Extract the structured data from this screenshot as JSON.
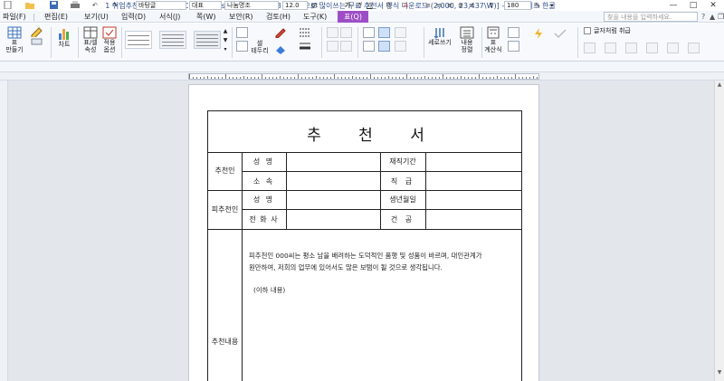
{
  "window": {
    "title": "1 취업추천서 양식.hwp [C:\\Users\\User\\Desktop\\338 일반적으로 많이쓰는 무료 추천서 양식 다운로드 (2,000, 23,437\\W)] - 한컴오피스 한글",
    "minimize": "—",
    "maximize": "□",
    "close": "✕"
  },
  "menu": {
    "items": [
      "파일(F)",
      "편집(E)",
      "보기(U)",
      "입력(D)",
      "서식(J)",
      "쪽(W)",
      "보안(R)",
      "검토(H)",
      "도구(K)"
    ],
    "active": "표(Q)",
    "search_placeholder": "찾을 내용을 입력하세요.",
    "help": "?",
    "collapse": "▲",
    "restore": "❐"
  },
  "ribbon": {
    "make_table": "표\n만들기",
    "chart": "차트",
    "table_cell_props": "표/셀\n속성",
    "apply_option": "적용\n옵션",
    "cell_border": "셀\n테두리",
    "vertical_write": "세로쓰기",
    "content_align": "내용\n정렬",
    "cell_calc": "표\n계산식",
    "keep_title_row": "글자처럼 취급"
  },
  "format": {
    "style": "바탕글",
    "lang": "대표",
    "font": "나눔명조",
    "size": "12.0",
    "size_unit": "pt",
    "bold": "가",
    "italic": "가",
    "underline": "가",
    "zoom": "180",
    "zoom_unit": "%"
  },
  "document": {
    "title": "추 천 서",
    "recommender_label": "추천인",
    "name_label": "성 명",
    "affiliation_label": "소 속",
    "employment_period_label": "재직기간",
    "position_label": "직 급",
    "recommendee_label": "피추천인",
    "birthdate_label": "생년월일",
    "phone_label": "전 화 사",
    "contact_label": "건 공",
    "content_label": "추천내용",
    "content_line1": "피추천인 000씨는 평소 남을 배려하는 도덕적인 품행 및 성품이 바르며, 대인관계가",
    "content_line2": "원만하여, 저희의 업무에 있어서도 많은 보탬이 될 것으로 생각됩니다.",
    "content_line3": "(이하 내용)"
  },
  "colors": {
    "active_tab": "#9d4ec6",
    "ribbon_bg": "#f7f9fc",
    "workspace_bg": "#e3e6eb"
  }
}
